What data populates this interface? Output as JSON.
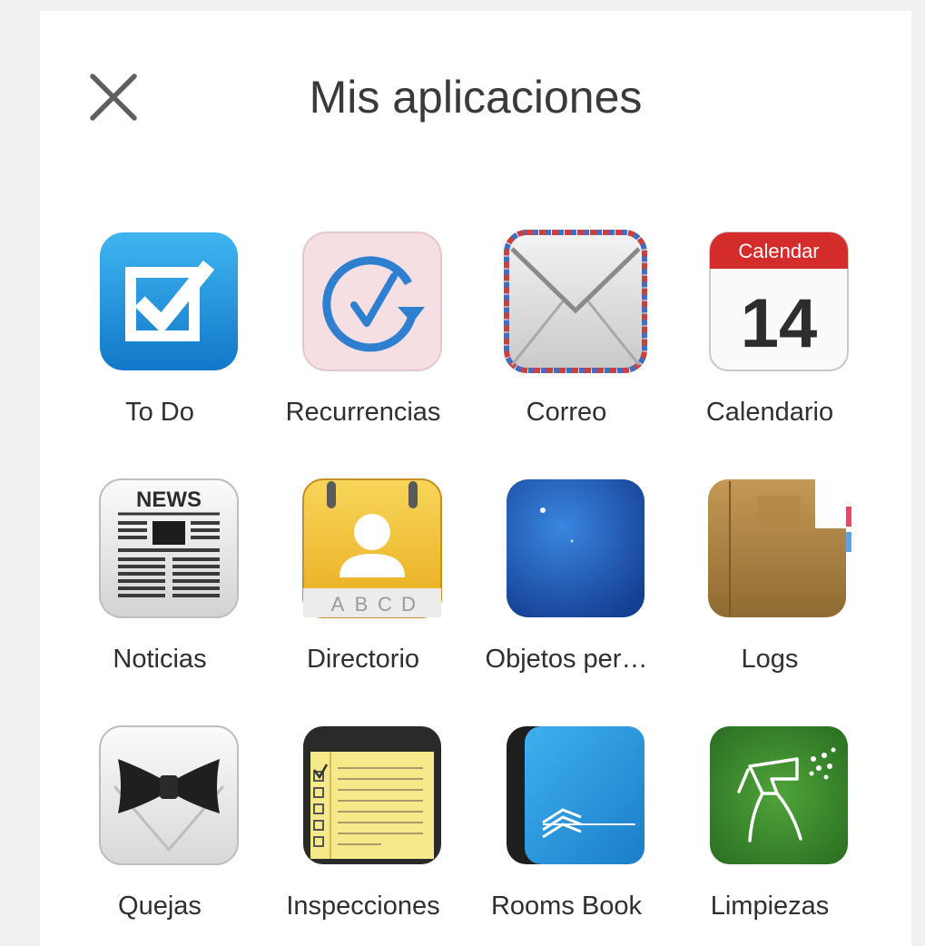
{
  "header": {
    "title": "Mis aplicaciones",
    "close_icon": "close-icon"
  },
  "apps": [
    {
      "label": "To Do",
      "icon": "todo-icon"
    },
    {
      "label": "Recurrencias",
      "icon": "recurrence-icon"
    },
    {
      "label": "Correo",
      "icon": "mail-icon"
    },
    {
      "label": "Calendario",
      "icon": "calendar-icon",
      "icon_header": "Calendar",
      "icon_day": "14"
    },
    {
      "label": "Noticias",
      "icon": "news-icon",
      "icon_header": "NEWS"
    },
    {
      "label": "Directorio",
      "icon": "directory-icon",
      "icon_tabs": [
        "A",
        "B",
        "C",
        "D"
      ]
    },
    {
      "label": "Objetos per…",
      "icon": "lost-items-icon"
    },
    {
      "label": "Logs",
      "icon": "logbook-icon"
    },
    {
      "label": "Quejas",
      "icon": "complaints-icon"
    },
    {
      "label": "Inspecciones",
      "icon": "inspection-notes-icon"
    },
    {
      "label": "Rooms Book",
      "icon": "rooms-book-icon"
    },
    {
      "label": "Limpiezas",
      "icon": "cleaning-spray-icon"
    }
  ],
  "colors": {
    "todo": "#1e9be3",
    "recurrence": "#2f7fd0",
    "calendar_red": "#d42b2b",
    "directory_yellow": "#f3c232",
    "lost_items_blue": "#1f56b8",
    "logbook_brown": "#a77c3e",
    "rooms_book_blue": "#2a9be0",
    "cleaning_green": "#3d8a2f"
  }
}
